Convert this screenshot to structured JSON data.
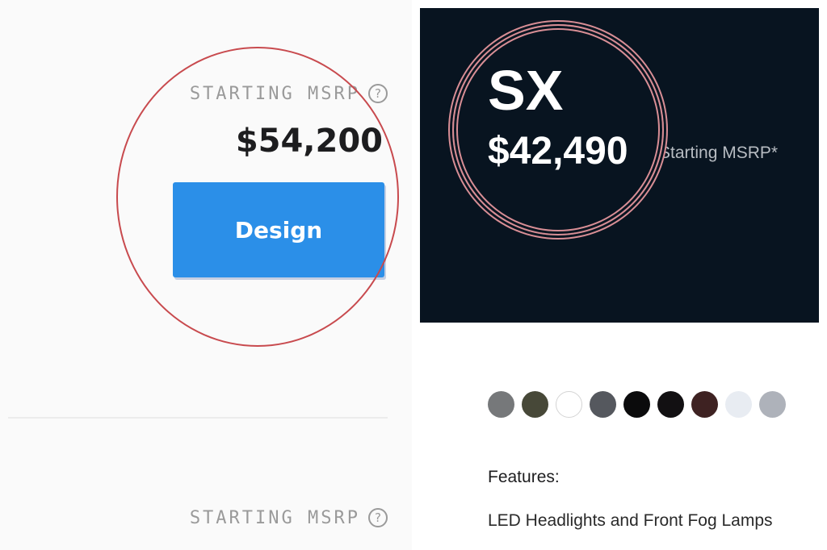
{
  "left": {
    "msrp_label": "STARTING MSRP",
    "price": "$54,200",
    "design_button": "Design",
    "msrp_label_bottom": "STARTING MSRP",
    "help_glyph": "?"
  },
  "right": {
    "trim": "SX",
    "price": "$42,490",
    "price_note": "Starting MSRP*",
    "swatches": [
      "#76787a",
      "#474838",
      "#ffffff",
      "#55585e",
      "#0b0b0c",
      "#121012",
      "#3e2222",
      "#e8ecf2",
      "#aeb2ba"
    ],
    "features_title": "Features:",
    "features_item": "LED Headlights and Front Fog Lamps"
  },
  "colors": {
    "button_blue": "#2b8fe8",
    "hero_navy": "#081420",
    "annotation_red": "#c84a4e"
  },
  "icons": [
    "question-circle-icon"
  ]
}
